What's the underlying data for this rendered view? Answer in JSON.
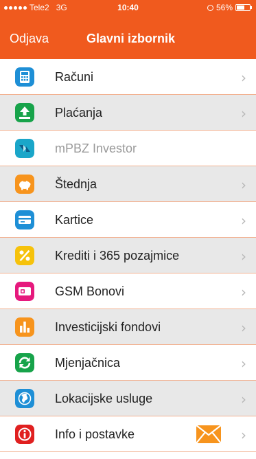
{
  "status_bar": {
    "carrier": "Tele2",
    "network": "3G",
    "time": "10:40",
    "battery": "56%"
  },
  "nav": {
    "back_label": "Odjava",
    "title": "Glavni izbornik"
  },
  "menu": {
    "items": [
      {
        "label": "Računi",
        "icon": "calculator-icon"
      },
      {
        "label": "Plaćanja",
        "icon": "upload-arrow-icon"
      },
      {
        "label": "mPBZ Investor",
        "icon": "investor-icon"
      },
      {
        "label": "Štednja",
        "icon": "piggy-bank-icon"
      },
      {
        "label": "Kartice",
        "icon": "card-icon"
      },
      {
        "label": "Krediti i 365 pozajmice",
        "icon": "percent-icon"
      },
      {
        "label": "GSM Bonovi",
        "icon": "sim-card-icon"
      },
      {
        "label": "Investicijski fondovi",
        "icon": "bar-chart-icon"
      },
      {
        "label": "Mjenjačnica",
        "icon": "exchange-icon"
      },
      {
        "label": "Lokacijske usluge",
        "icon": "globe-icon"
      },
      {
        "label": "Info i postavke",
        "icon": "info-icon"
      }
    ],
    "chevron": "›"
  },
  "colors": {
    "header": "#f05a1e",
    "row_divider": "#f2b08f",
    "row_gray": "#e8e8e8"
  }
}
